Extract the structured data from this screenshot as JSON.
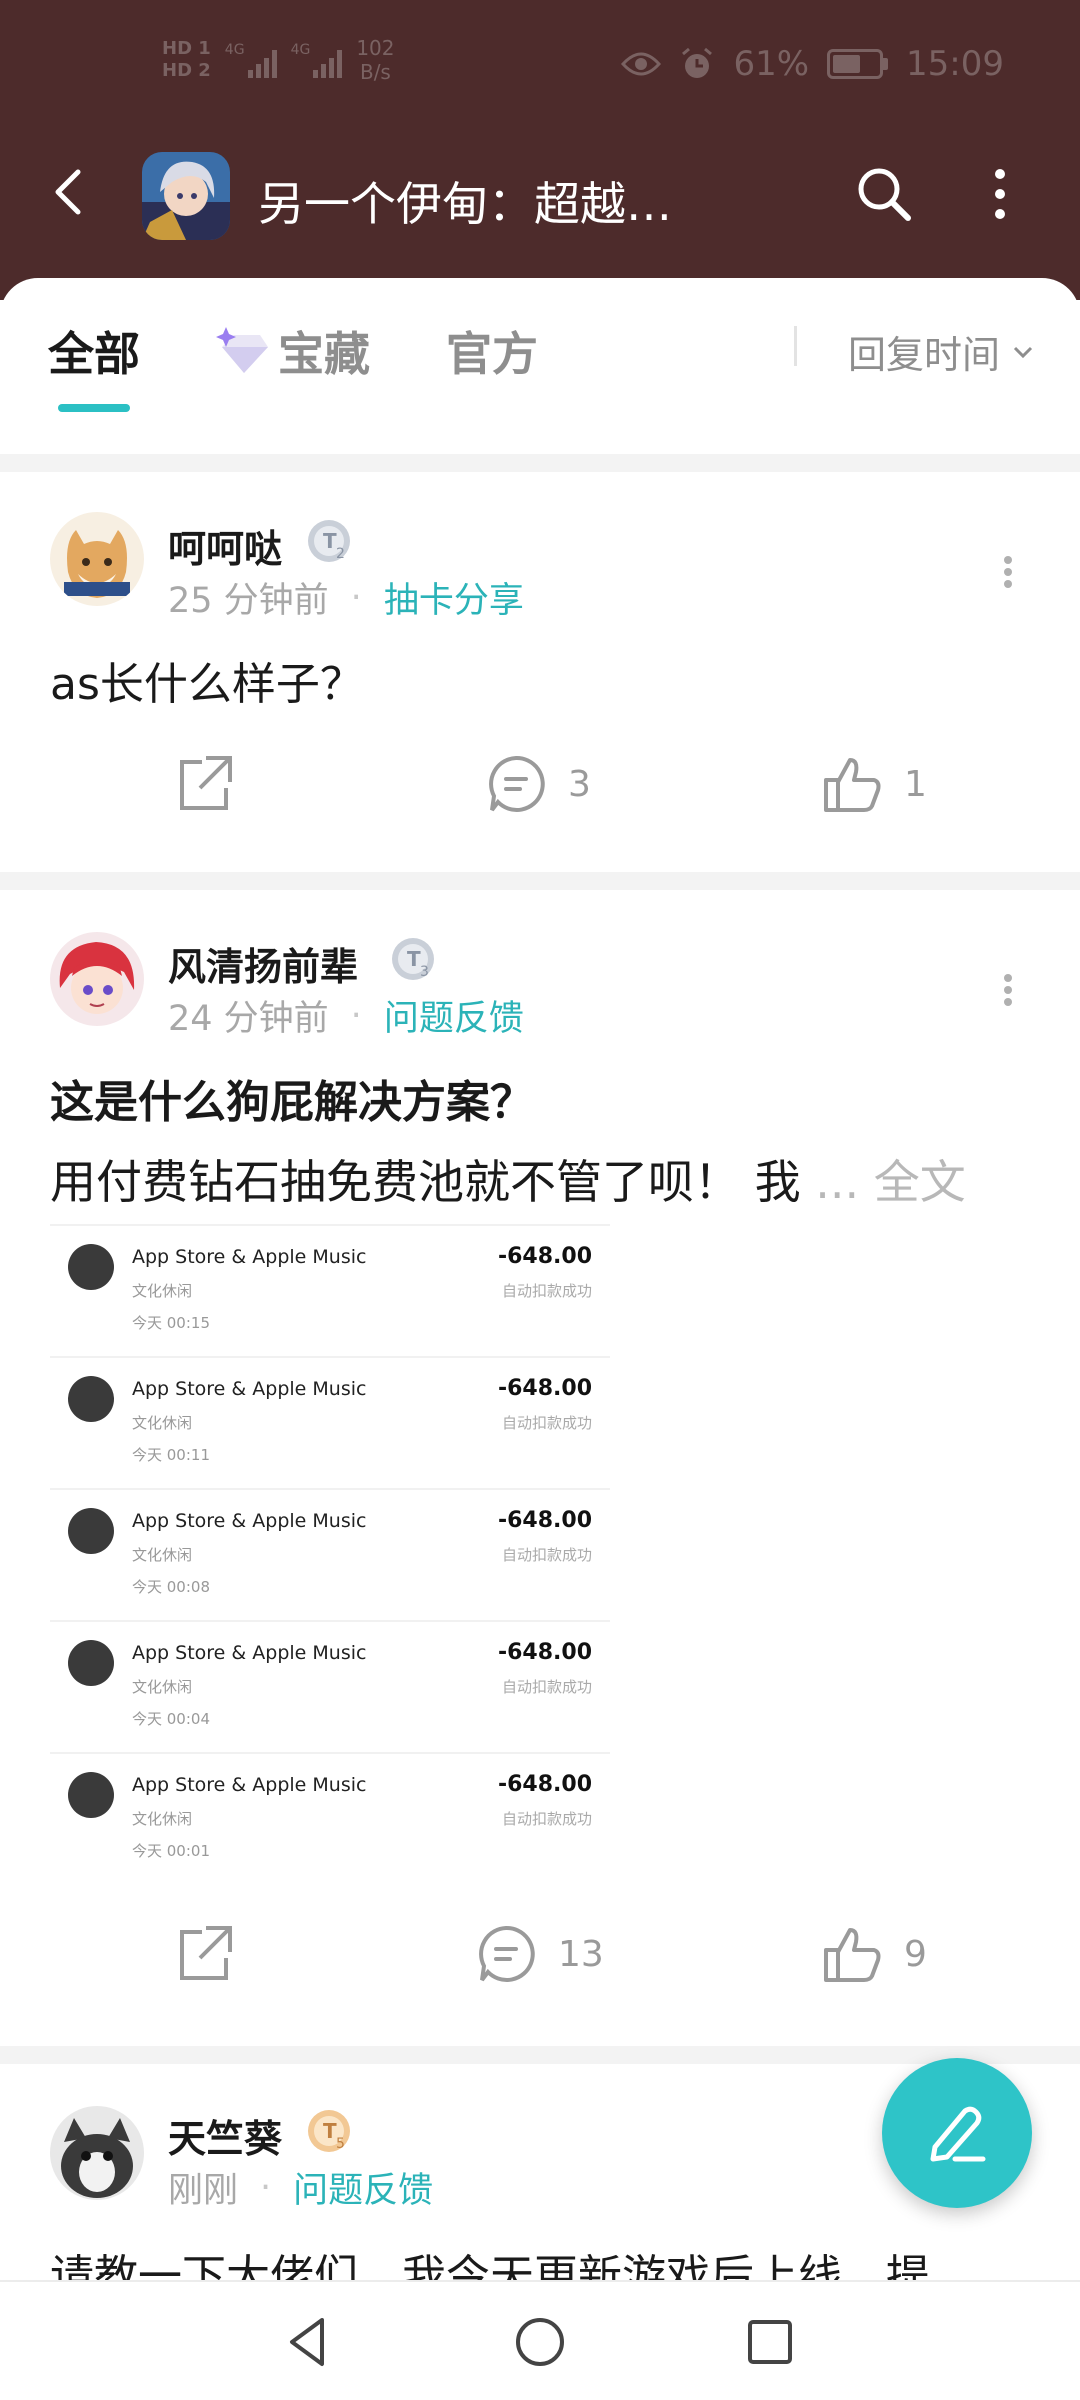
{
  "status_bar": {
    "hd1": "HD 1",
    "hd2": "HD 2",
    "net1": "4G",
    "net2": "4G",
    "speed_value": "102",
    "speed_unit": "B/s",
    "battery_percent": "61%",
    "battery_level": 0.61,
    "time": "15:09"
  },
  "header": {
    "title": "另一个伊甸：超越…",
    "back_icon": "chevron-left-icon",
    "search_icon": "search-icon",
    "more_icon": "more-vertical-icon"
  },
  "tabs": [
    {
      "label": "全部",
      "active": true
    },
    {
      "label": "宝藏",
      "active": false,
      "icon": "diamond-icon"
    },
    {
      "label": "官方",
      "active": false
    }
  ],
  "sort": {
    "label": "回复时间"
  },
  "posts": [
    {
      "username": "呵呵哒",
      "level": "2",
      "time": "25 分钟前",
      "category": "抽卡分享",
      "text": "as长什么样子？",
      "comments": "3",
      "likes": "1"
    },
    {
      "username": "风清扬前辈",
      "level": "3",
      "time": "24 分钟前",
      "category": "问题反馈",
      "title": "这是什么狗屁解决方案？",
      "body": "用付费钻石抽免费池就不管了呗！ 我",
      "more_label": "... 全文",
      "comments": "13",
      "likes": "9",
      "receipts": [
        {
          "merchant": "App Store & Apple Music",
          "category": "文化休闲",
          "time": "今天  00:15",
          "amount": "-648.00",
          "status": "自动扣款成功"
        },
        {
          "merchant": "App Store & Apple Music",
          "category": "文化休闲",
          "time": "今天  00:11",
          "amount": "-648.00",
          "status": "自动扣款成功"
        },
        {
          "merchant": "App Store & Apple Music",
          "category": "文化休闲",
          "time": "今天  00:08",
          "amount": "-648.00",
          "status": "自动扣款成功"
        },
        {
          "merchant": "App Store & Apple Music",
          "category": "文化休闲",
          "time": "今天  00:04",
          "amount": "-648.00",
          "status": "自动扣款成功"
        },
        {
          "merchant": "App Store & Apple Music",
          "category": "文化休闲",
          "time": "今天  00:01",
          "amount": "-648.00",
          "status": "自动扣款成功"
        }
      ]
    },
    {
      "username": "天竺葵",
      "level": "5",
      "time": "刚刚",
      "category": "问题反馈",
      "text": "请教一下大佬们，我今天更新游戏后上线，提"
    }
  ],
  "colors": {
    "header_bg": "#4d2b2b",
    "accent": "#2bc0c4",
    "category": "#2bb3b8"
  },
  "fab": {
    "icon": "pen-icon"
  },
  "nav": {
    "back": "nav-back-icon",
    "home": "nav-home-icon",
    "recents": "nav-recents-icon"
  }
}
